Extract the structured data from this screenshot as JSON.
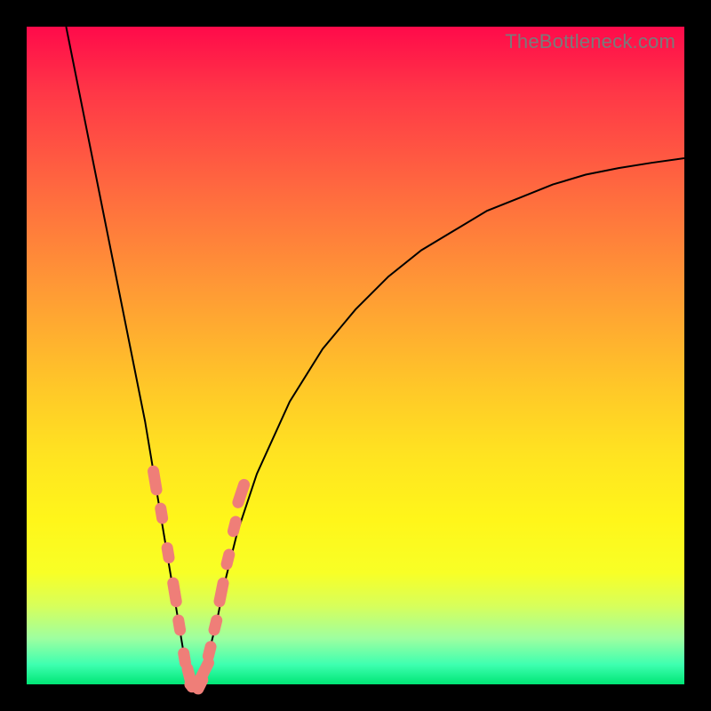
{
  "watermark": "TheBottleneck.com",
  "colors": {
    "marker": "#ef7e78",
    "curve": "#000000",
    "frame_bg_top": "#ff0a4a",
    "frame_bg_bottom": "#00e676",
    "page_bg": "#000000"
  },
  "chart_data": {
    "type": "line",
    "title": "",
    "xlabel": "",
    "ylabel": "",
    "xlim": [
      0,
      100
    ],
    "ylim": [
      0,
      100
    ],
    "notes": "V-shaped bottleneck curve; y ≈ mismatch percentage (100 = top/red, 0 = bottom/green). Minimum near x ≈ 25. Right branch asymptotes toward ~80 at x = 100.",
    "series": [
      {
        "name": "bottleneck-curve",
        "x": [
          6,
          8,
          10,
          12,
          14,
          16,
          18,
          20,
          21,
          22,
          23,
          24,
          25,
          26,
          27,
          28,
          29,
          30,
          32,
          35,
          40,
          45,
          50,
          55,
          60,
          65,
          70,
          75,
          80,
          85,
          90,
          95,
          100
        ],
        "y": [
          100,
          90,
          80,
          70,
          60,
          50,
          40,
          28,
          22,
          16,
          10,
          4,
          0,
          0,
          2,
          6,
          10,
          15,
          23,
          32,
          43,
          51,
          57,
          62,
          66,
          69,
          72,
          74,
          76,
          77.5,
          78.5,
          79.3,
          80
        ]
      }
    ],
    "markers": {
      "name": "highlighted-points",
      "shape": "rounded-capsule",
      "x": [
        19.5,
        20.5,
        21.5,
        22.5,
        23.2,
        24.0,
        24.8,
        25.6,
        26.4,
        27.0,
        27.8,
        28.7,
        29.6,
        30.6,
        31.6,
        32.6
      ],
      "y": [
        31,
        26,
        20,
        14,
        9,
        4,
        1,
        0,
        0,
        2,
        5,
        9,
        14,
        19,
        24,
        29
      ]
    }
  }
}
